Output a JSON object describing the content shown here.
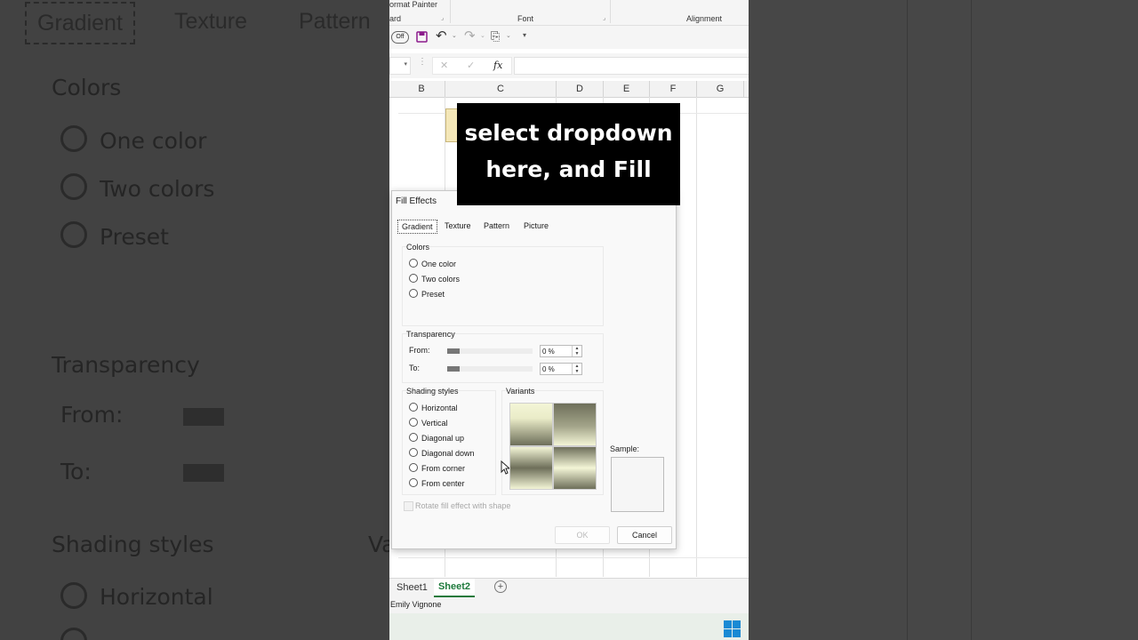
{
  "background_zoom": {
    "tabs": [
      "Gradient",
      "Texture",
      "Pattern"
    ],
    "colors_label": "Colors",
    "radios": [
      "One color",
      "Two colors",
      "Preset"
    ],
    "transparency_label": "Transparency",
    "from_label": "From:",
    "to_label": "To:",
    "shading_label": "Shading styles",
    "shading_first": "Horizontal",
    "variants_partial": "Va"
  },
  "ribbon": {
    "format_painter": "ormat Painter",
    "clipboard_partial": "ard",
    "font_group": "Font",
    "alignment_group": "Alignment"
  },
  "qat": {
    "autosave": "Off"
  },
  "formula_bar": {
    "fx": "fx",
    "cancel": "✕",
    "enter": "✓"
  },
  "columns": [
    "B",
    "C",
    "D",
    "E",
    "F",
    "G"
  ],
  "caption": {
    "line1": "select dropdown",
    "line2": "here, and Fill"
  },
  "dialog": {
    "title": "Fill Effects",
    "tabs": [
      "Gradient",
      "Texture",
      "Pattern",
      "Picture"
    ],
    "colors": {
      "label": "Colors",
      "options": [
        "One color",
        "Two colors",
        "Preset"
      ]
    },
    "transparency": {
      "label": "Transparency",
      "from_label": "From:",
      "to_label": "To:",
      "from_value": "0 %",
      "to_value": "0 %"
    },
    "shading": {
      "label": "Shading styles",
      "options": [
        "Horizontal",
        "Vertical",
        "Diagonal up",
        "Diagonal down",
        "From corner",
        "From center"
      ]
    },
    "variants_label": "Variants",
    "sample_label": "Sample:",
    "rotate_label": "Rotate fill effect with shape",
    "ok": "OK",
    "cancel": "Cancel"
  },
  "sheets": [
    "Sheet1",
    "Sheet2"
  ],
  "status_user": "Emily Vignone",
  "colors": {
    "gradient_light": "#f3f5d6",
    "gradient_dark": "#6e6f5a",
    "caption_bg": "#000000",
    "active_sheet": "#1e7a3c"
  }
}
